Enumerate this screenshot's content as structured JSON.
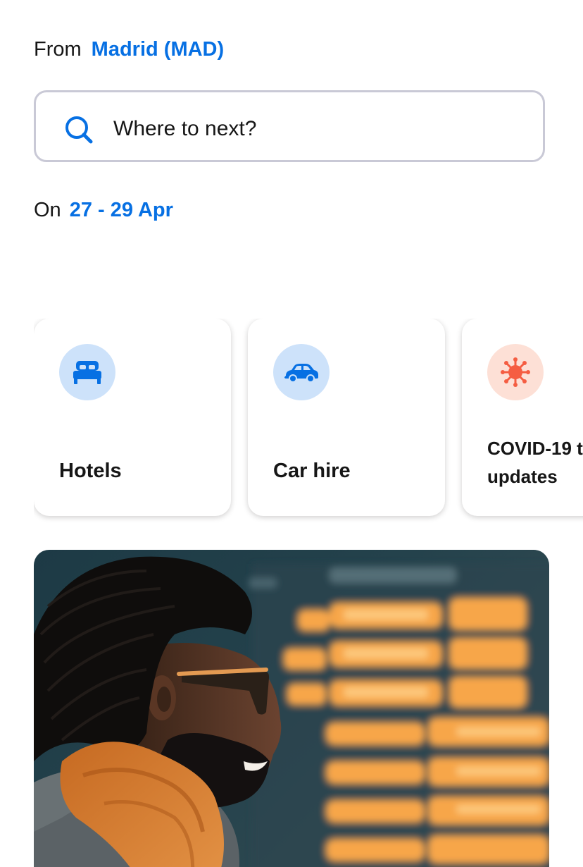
{
  "origin": {
    "prefix": "From",
    "value": "Madrid (MAD)"
  },
  "search": {
    "placeholder": "Where to next?",
    "icon": "search-icon"
  },
  "dates": {
    "prefix": "On",
    "value": "27 - 29 Apr"
  },
  "services": [
    {
      "label": "Hotels",
      "icon": "bed-icon"
    },
    {
      "label": "Car hire",
      "icon": "car-icon"
    },
    {
      "label_line1": "COVID-19 t",
      "label_line2": "updates",
      "icon": "virus-icon"
    }
  ],
  "colors": {
    "accent": "#0770e3",
    "icon_bg_blue": "#cde2fa",
    "icon_bg_orange": "#fde0d6",
    "covid_icon": "#f55d42"
  },
  "hero": {
    "image": "traveler-smiling-at-departures-board-photo"
  }
}
